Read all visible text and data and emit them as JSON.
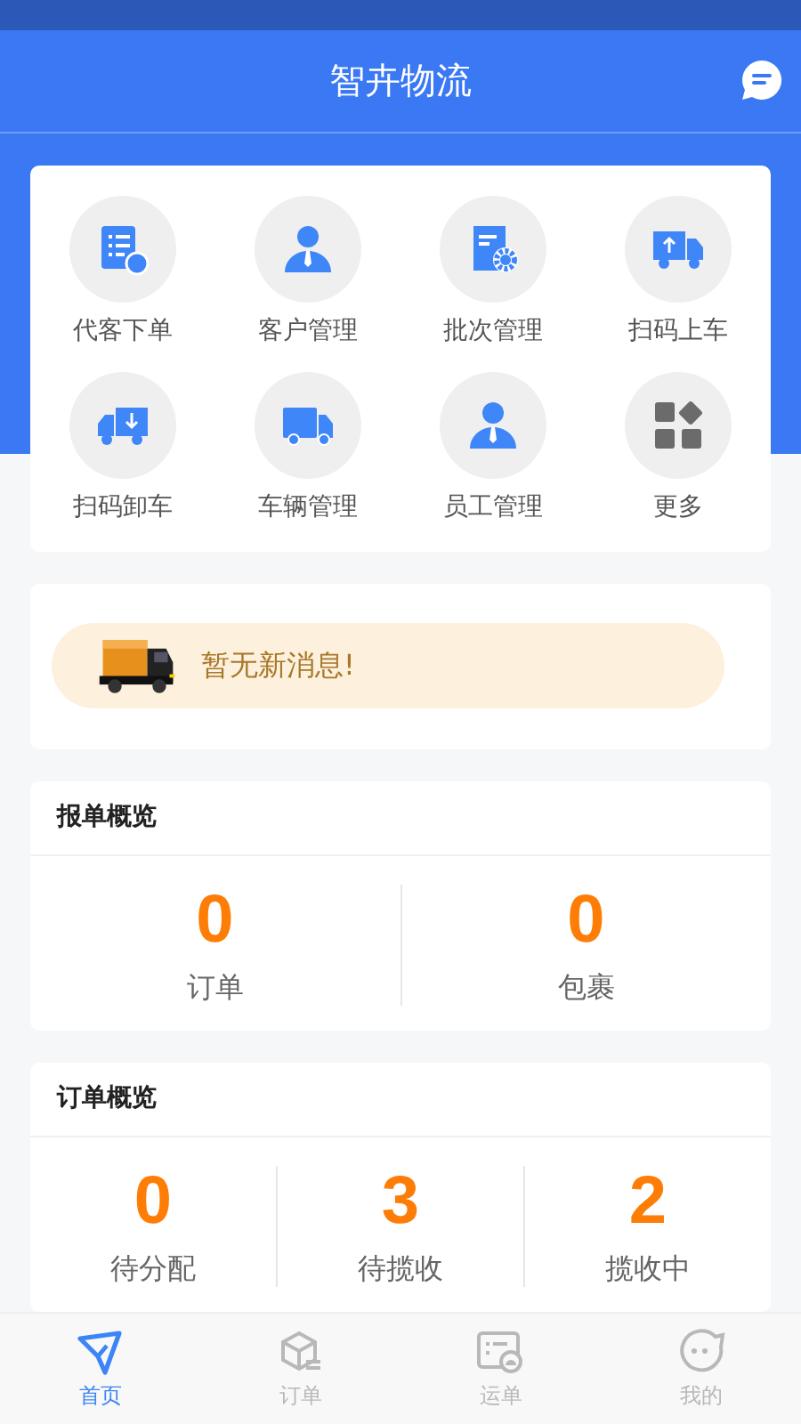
{
  "header": {
    "title": "智卉物流"
  },
  "menu": [
    {
      "label": "代客下单",
      "kind": "order"
    },
    {
      "label": "客户管理",
      "kind": "person"
    },
    {
      "label": "批次管理",
      "kind": "batch"
    },
    {
      "label": "扫码上车",
      "kind": "load"
    },
    {
      "label": "扫码卸车",
      "kind": "unload"
    },
    {
      "label": "车辆管理",
      "kind": "truck"
    },
    {
      "label": "员工管理",
      "kind": "person"
    },
    {
      "label": "更多",
      "kind": "more"
    }
  ],
  "notice": {
    "text": "暂无新消息!"
  },
  "report_overview": {
    "title": "报单概览",
    "stats": [
      {
        "value": "0",
        "label": "订单"
      },
      {
        "value": "0",
        "label": "包裹"
      }
    ]
  },
  "order_overview": {
    "title": "订单概览",
    "stats": [
      {
        "value": "0",
        "label": "待分配"
      },
      {
        "value": "3",
        "label": "待揽收"
      },
      {
        "value": "2",
        "label": "揽收中"
      }
    ]
  },
  "tab_bar": [
    {
      "label": "首页",
      "kind": "home",
      "selected": true
    },
    {
      "label": "订单",
      "kind": "orders",
      "selected": false
    },
    {
      "label": "运单",
      "kind": "waybill",
      "selected": false
    },
    {
      "label": "我的",
      "kind": "me",
      "selected": false
    }
  ]
}
